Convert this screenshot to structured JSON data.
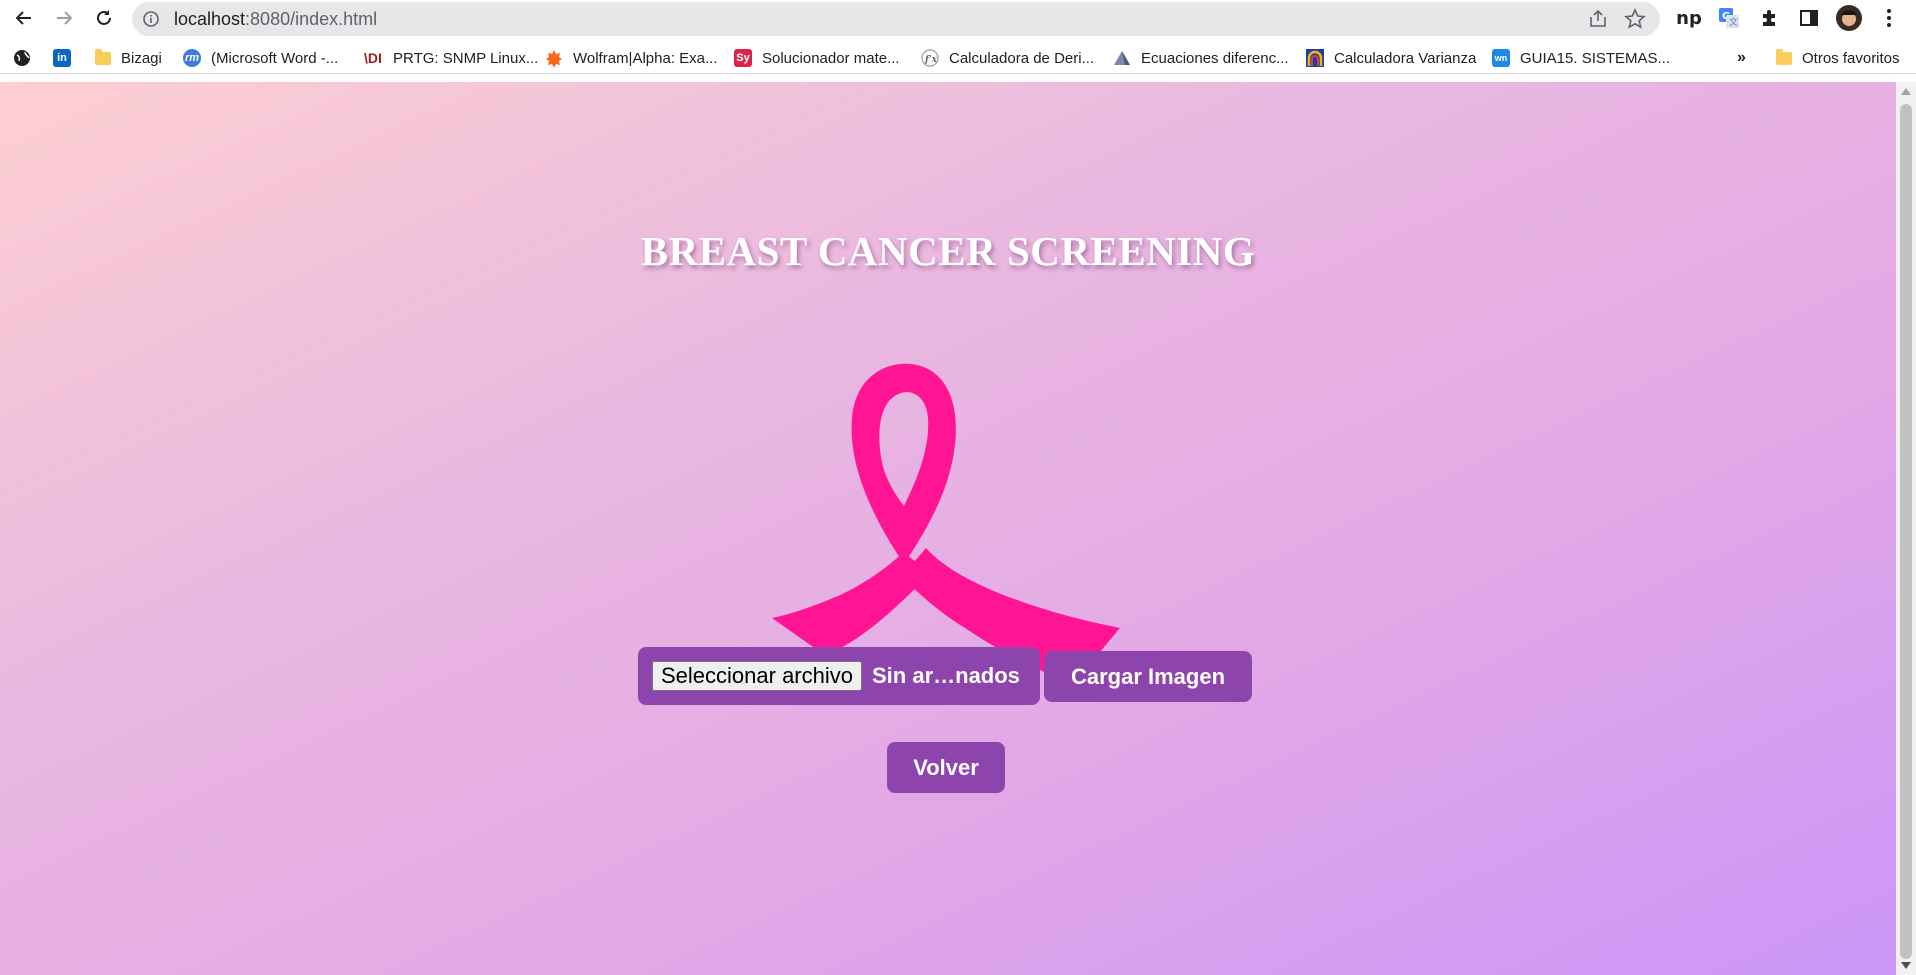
{
  "browser": {
    "url_host": "localhost",
    "url_rest": ":8080/index.html"
  },
  "extensions": {
    "np_label": "np"
  },
  "bookmarks": [
    {
      "label": "",
      "icon": "globe-icon"
    },
    {
      "label": "",
      "icon": "linkedin-icon"
    },
    {
      "label": "Bizagi",
      "icon": "folder-icon"
    },
    {
      "label": "(Microsoft Word -...",
      "icon": "rm-icon"
    },
    {
      "label": "PRTG: SNMP Linux...",
      "icon": "prtg-icon"
    },
    {
      "label": "Wolfram|Alpha: Exa...",
      "icon": "wolfram-icon"
    },
    {
      "label": "Solucionador mate...",
      "icon": "sy-icon"
    },
    {
      "label": "Calculadora de Deri...",
      "icon": "derivative-icon"
    },
    {
      "label": "Ecuaciones diferenc...",
      "icon": "pyramid-icon"
    },
    {
      "label": "Calculadora Varianza",
      "icon": "arc-icon"
    },
    {
      "label": "GUIA15. SISTEMAS...",
      "icon": "wn-icon"
    }
  ],
  "bookmarks_overflow": "»",
  "other_bookmarks": "Otros favoritos",
  "page": {
    "title": "BREAST CANCER SCREENING",
    "file_button": "Seleccionar archivo",
    "file_status": "Sin ar…nados",
    "upload_button": "Cargar Imagen",
    "back_button": "Volver"
  },
  "colors": {
    "ribbon": "#ff1493",
    "button": "#8e44ad",
    "gradient_start": "#fdcfd2",
    "gradient_end": "#cc96f8"
  }
}
